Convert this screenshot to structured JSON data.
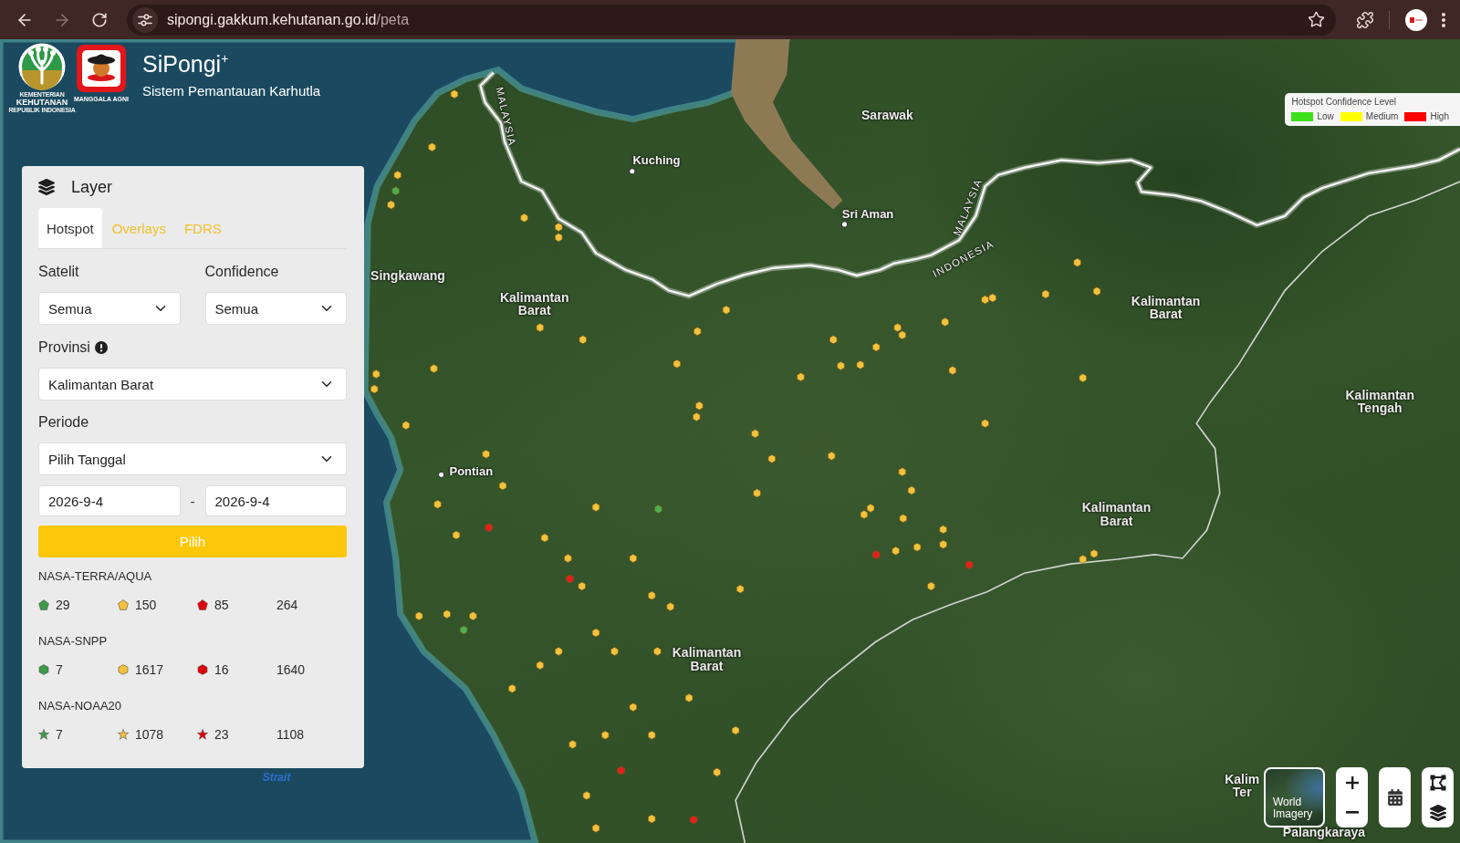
{
  "browser": {
    "url": {
      "host": "sipongi.gakkum.kehutanan.go.id",
      "path": "/peta"
    },
    "forward_disabled": true
  },
  "header": {
    "ministry_logo": {
      "top": "KEMENTERIAN",
      "name": "KEHUTANAN",
      "bottom": "REPUBLIK INDONESIA"
    },
    "agency_logo": {
      "caption": "MANGGALA AGNI"
    },
    "title": "SiPongi$^{+}$",
    "subtitle": "Sistem Pemantauan Karhutla"
  },
  "legend": {
    "title": "Hotspot Confidence Level",
    "items": [
      {
        "label": "Low",
        "color": "#3ee01e"
      },
      {
        "label": "Medium",
        "color": "#ffff00"
      },
      {
        "label": "High",
        "color": "#ff0000"
      }
    ]
  },
  "layer_panel": {
    "title": "Layer",
    "tabs": [
      {
        "label": "Hotspot",
        "selected": true
      },
      {
        "label": "Overlays",
        "selected": false
      },
      {
        "label": "FDRS",
        "selected": false
      }
    ],
    "filters": [
      {
        "label": "Satelit",
        "value": "Semua"
      },
      {
        "label": "Confidence",
        "value": "Semua"
      }
    ],
    "province": {
      "label": "Provinsi",
      "value": "Kalimantan Barat"
    },
    "period": {
      "label": "Periode",
      "value": "Pilih Tanggal",
      "date_from": "2026-9-4",
      "separator": "-",
      "date_to": "2026-9-4"
    },
    "submit": "Pilih",
    "satellites": [
      {
        "name": "NASA-TERRA/AQUA",
        "kind": "pentagon",
        "counts": [
          {
            "value": "29",
            "color": "#3c9b47"
          },
          {
            "value": "150",
            "color": "#f3c03c"
          },
          {
            "value": "85",
            "color": "#e0000c"
          }
        ],
        "total": "264"
      },
      {
        "name": "NASA-SNPP",
        "kind": "hexagon",
        "counts": [
          {
            "value": "7",
            "color": "#3c9b47"
          },
          {
            "value": "1617",
            "color": "#f3c03c"
          },
          {
            "value": "16",
            "color": "#e0000c"
          }
        ],
        "total": "1640"
      },
      {
        "name": "NASA-NOAA20",
        "kind": "star",
        "counts": [
          {
            "value": "7",
            "color": "#3c9b47"
          },
          {
            "value": "1078",
            "color": "#f3c03c"
          },
          {
            "value": "23",
            "color": "#e0000c"
          }
        ],
        "total": "1108"
      }
    ]
  },
  "map": {
    "labels": [
      {
        "kind": "region",
        "lines": [
          "Sarawak"
        ]
      },
      {
        "kind": "city",
        "lines": [
          "Kuching"
        ]
      },
      {
        "kind": "city",
        "lines": [
          "Sri Aman"
        ]
      },
      {
        "kind": "region",
        "lines": [
          "Singkawang"
        ]
      },
      {
        "kind": "region",
        "lines": [
          "Kalimantan",
          "Barat"
        ]
      },
      {
        "kind": "region",
        "lines": [
          "Kalimantan",
          "Barat"
        ]
      },
      {
        "kind": "region",
        "lines": [
          "Kalimantan",
          "Tengah"
        ]
      },
      {
        "kind": "region",
        "lines": [
          "Kalimantan",
          "Barat"
        ]
      },
      {
        "kind": "region",
        "lines": [
          "Kalimantan",
          "Barat"
        ]
      },
      {
        "kind": "city",
        "lines": [
          "Pontian"
        ]
      },
      {
        "kind": "region",
        "lines": [
          "Kalim",
          "Ter"
        ]
      },
      {
        "kind": "region",
        "lines": [
          "Palangkaraya"
        ]
      },
      {
        "kind": "country",
        "lines": [
          "MALAYSIA"
        ]
      },
      {
        "kind": "country",
        "lines": [
          "MALAYSIA"
        ]
      },
      {
        "kind": "country",
        "lines": [
          "INDONESIA"
        ]
      },
      {
        "kind": "water",
        "lines": [
          "Strait"
        ]
      }
    ],
    "hotspots": [
      {
        "color": "#f2c23e"
      },
      {
        "color": "#f2c23e"
      },
      {
        "color": "#f2c23e"
      },
      {
        "color": "#4caf50"
      },
      {
        "color": "#f2c23e"
      },
      {
        "color": "#f2c23e"
      },
      {
        "color": "#f2c23e"
      },
      {
        "color": "#f2c23e"
      },
      {
        "color": "#f2c23e"
      },
      {
        "color": "#f2c23e"
      },
      {
        "color": "#f2c23e"
      },
      {
        "color": "#f2c23e"
      },
      {
        "color": "#f2c23e"
      },
      {
        "color": "#f2c23e"
      },
      {
        "color": "#f2c23e"
      },
      {
        "color": "#f2c23e"
      },
      {
        "color": "#f2c23e"
      },
      {
        "color": "#f2c23e"
      },
      {
        "color": "#f2c23e"
      },
      {
        "color": "#f2c23e"
      },
      {
        "color": "#f2c23e"
      },
      {
        "color": "#f2c23e"
      },
      {
        "color": "#f2c23e"
      },
      {
        "color": "#f2c23e"
      },
      {
        "color": "#f2c23e"
      },
      {
        "color": "#f2c23e"
      },
      {
        "color": "#f2c23e"
      },
      {
        "color": "#f2c23e"
      },
      {
        "color": "#f2c23e"
      },
      {
        "color": "#f2c23e"
      },
      {
        "color": "#f2c23e"
      },
      {
        "color": "#f2c23e"
      },
      {
        "color": "#f2c23e"
      },
      {
        "color": "#f2c23e"
      },
      {
        "color": "#f2c23e"
      },
      {
        "color": "#f2c23e"
      },
      {
        "color": "#f2c23e"
      },
      {
        "color": "#f2c23e"
      },
      {
        "color": "#f2c23e"
      },
      {
        "color": "#f2c23e"
      },
      {
        "color": "#f2c23e"
      },
      {
        "color": "#f2c23e"
      },
      {
        "color": "#f2c23e"
      },
      {
        "color": "#f2c23e"
      },
      {
        "color": "#f2c23e"
      },
      {
        "color": "#f2c23e"
      },
      {
        "color": "#e3201b"
      },
      {
        "color": "#e3201b"
      },
      {
        "color": "#f2c23e"
      },
      {
        "color": "#f2c23e"
      },
      {
        "color": "#f2c23e"
      },
      {
        "color": "#4caf50"
      },
      {
        "color": "#e3201b"
      },
      {
        "color": "#e3201b"
      },
      {
        "color": "#f2c23e"
      },
      {
        "color": "#f2c23e"
      },
      {
        "color": "#f2c23e"
      },
      {
        "color": "#f2c23e"
      },
      {
        "color": "#f2c23e"
      },
      {
        "color": "#f2c23e"
      },
      {
        "color": "#f2c23e"
      },
      {
        "color": "#f2c23e"
      },
      {
        "color": "#f2c23e"
      },
      {
        "color": "#f2c23e"
      },
      {
        "color": "#f2c23e"
      },
      {
        "color": "#f2c23e"
      },
      {
        "color": "#f2c23e"
      },
      {
        "color": "#f2c23e"
      },
      {
        "color": "#f2c23e"
      },
      {
        "color": "#f2c23e"
      },
      {
        "color": "#f2c23e"
      },
      {
        "color": "#f2c23e"
      },
      {
        "color": "#f2c23e"
      },
      {
        "color": "#f2c23e"
      },
      {
        "color": "#e3201b"
      },
      {
        "color": "#f2c23e"
      },
      {
        "color": "#f2c23e"
      },
      {
        "color": "#f2c23e"
      },
      {
        "color": "#e3201b"
      },
      {
        "color": "#f2c23e"
      },
      {
        "color": "#f2c23e"
      },
      {
        "color": "#f2c23e"
      },
      {
        "color": "#4caf50"
      },
      {
        "color": "#f2c23e"
      },
      {
        "color": "#f2c23e"
      },
      {
        "color": "#f2c23e"
      },
      {
        "color": "#f2c23e"
      },
      {
        "color": "#f2c23e"
      },
      {
        "color": "#f2c23e"
      },
      {
        "color": "#f2c23e"
      }
    ]
  },
  "map_controls": {
    "basemap": {
      "label": "World Imagery"
    }
  }
}
